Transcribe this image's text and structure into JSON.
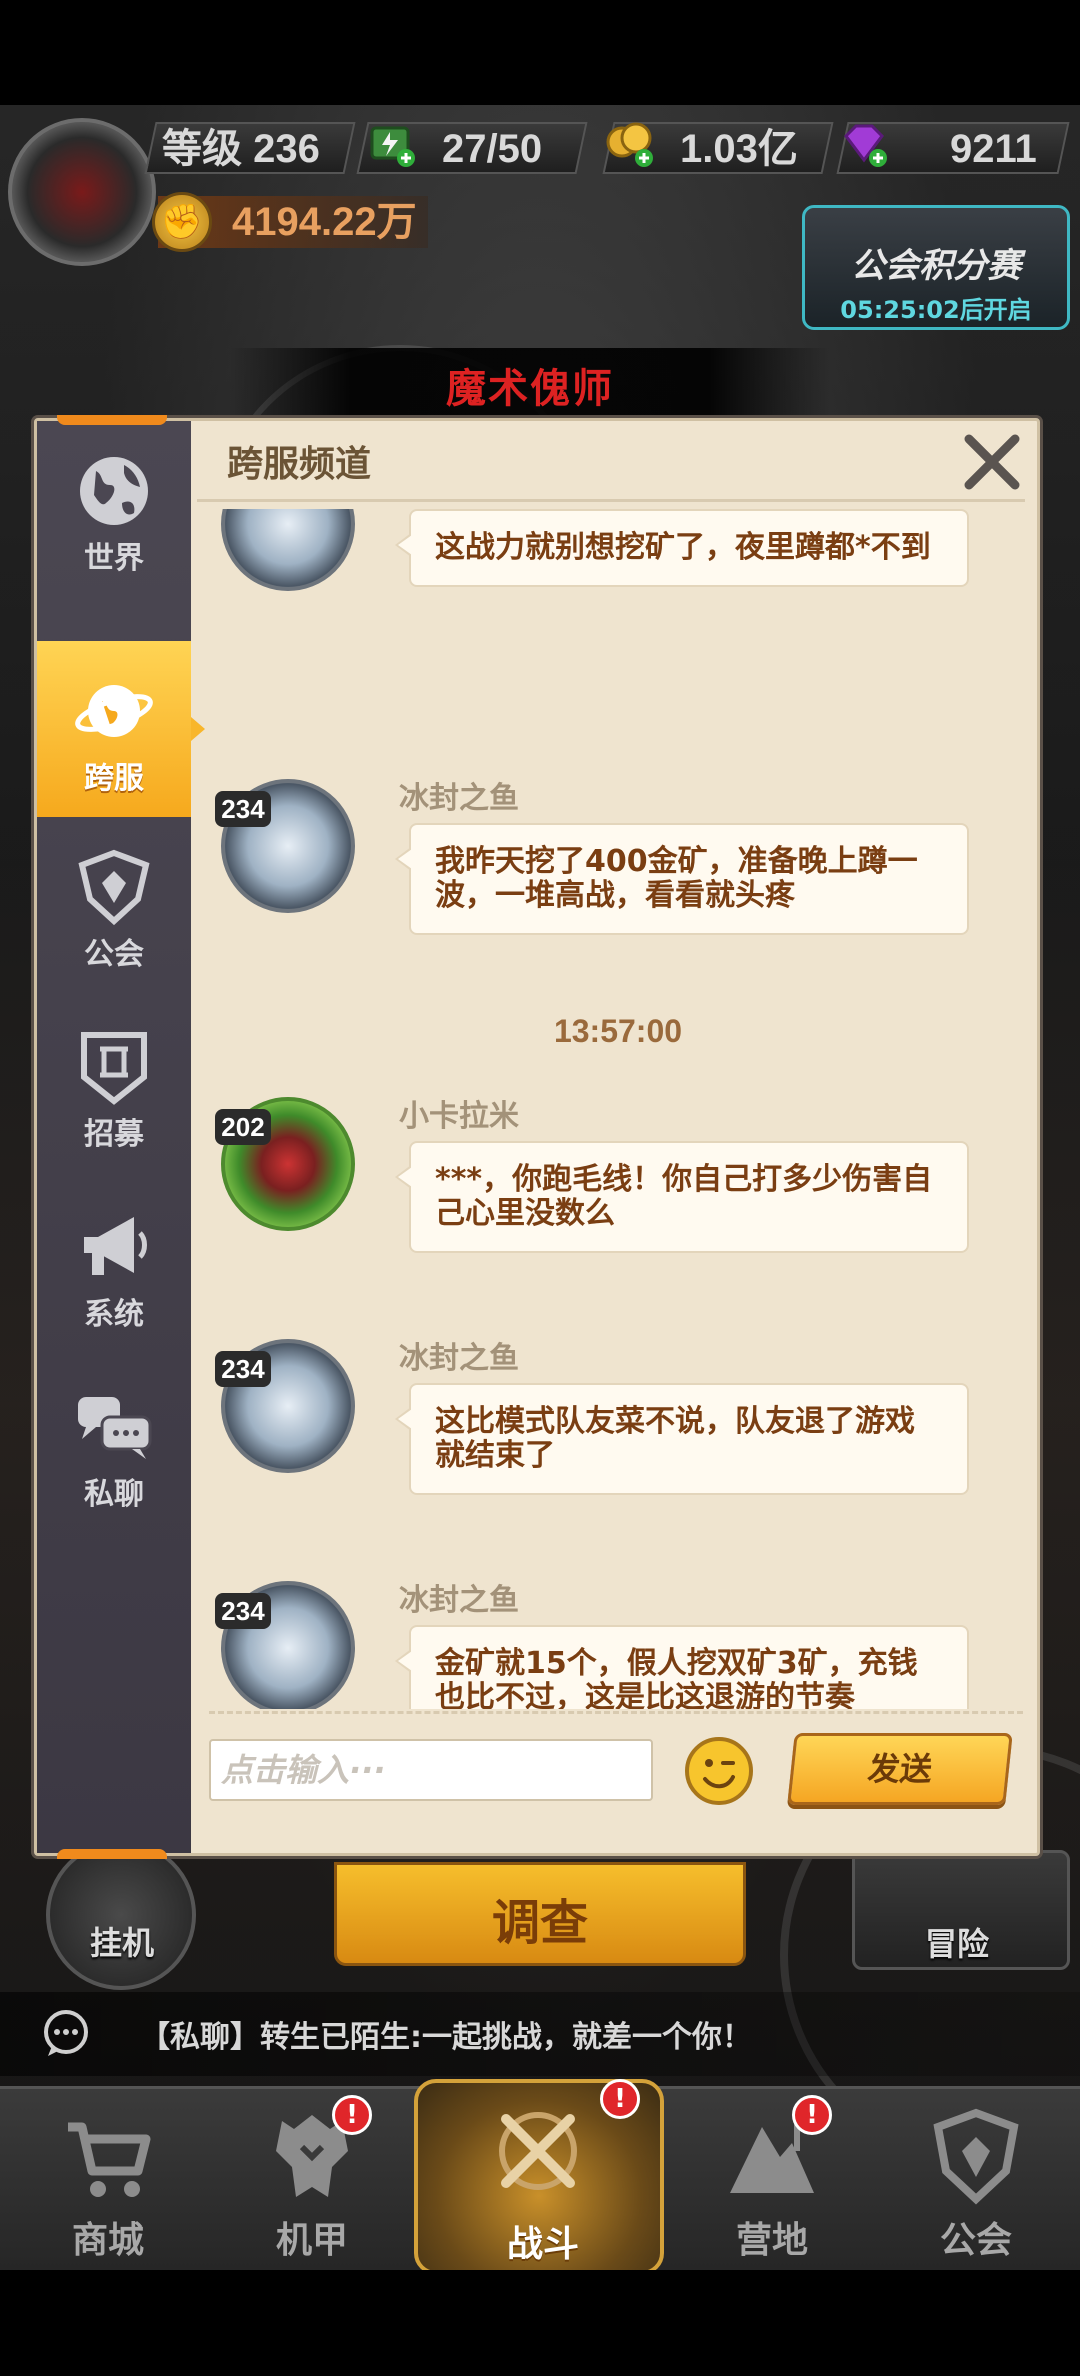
{
  "hud": {
    "level_label": "等级 236",
    "stamina": "27/50",
    "gold": "1.03亿",
    "gems": "9211",
    "power": "4194.22万"
  },
  "event": {
    "title": "公会积分赛",
    "timer": "05:25:02后开启"
  },
  "boss": {
    "name": "魔术傀师"
  },
  "dialog": {
    "title": "跨服频道",
    "tabs": [
      {
        "label": "世界",
        "icon": "globe-icon",
        "active": false
      },
      {
        "label": "跨服",
        "icon": "planet-icon",
        "active": true
      },
      {
        "label": "公会",
        "icon": "guild-shield-icon",
        "active": false
      },
      {
        "label": "招募",
        "icon": "recruit-icon",
        "active": false
      },
      {
        "label": "系统",
        "icon": "megaphone-icon",
        "active": false
      },
      {
        "label": "私聊",
        "icon": "chat-bubbles-icon",
        "active": false
      }
    ],
    "messages": [
      {
        "name": "",
        "level": "",
        "avatar": "silver-mech",
        "text": "这战力就别想挖矿了，夜里蹲都*不到"
      },
      {
        "name": "冰封之鱼",
        "level": "234",
        "avatar": "silver-mech",
        "text": "我昨天挖了400金矿，准备晚上蹲一波，一堆高战，看看就头疼"
      },
      {
        "name": "小卡拉米",
        "level": "202",
        "avatar": "green-mech",
        "text": "***，你跑毛线！你自己打多少伤害自己心里没数么"
      },
      {
        "name": "冰封之鱼",
        "level": "234",
        "avatar": "silver-mech",
        "text": "这比模式队友菜不说，队友退了游戏就结束了"
      },
      {
        "name": "冰封之鱼",
        "level": "234",
        "avatar": "silver-mech",
        "text": "金矿就15个，假人挖双矿3矿，充钱也比不过，这是比这退游的节奏"
      }
    ],
    "timestamp": "13:57:00",
    "input_placeholder": "点击输入···",
    "send_label": "发送"
  },
  "scene": {
    "idle_label": "挂机",
    "investigate_label": "调查",
    "adventure_label": "冒险"
  },
  "ticker": {
    "text": "【私聊】转生已陌生:一起挑战，就差一个你！"
  },
  "nav": [
    {
      "label": "商城",
      "icon": "cart-icon",
      "badge": false,
      "active": false
    },
    {
      "label": "机甲",
      "icon": "mech-icon",
      "badge": true,
      "active": false
    },
    {
      "label": "战斗",
      "icon": "crossed-swords-icon",
      "badge": true,
      "active": true
    },
    {
      "label": "营地",
      "icon": "camp-icon",
      "badge": true,
      "active": false
    },
    {
      "label": "公会",
      "icon": "guild-shield-icon",
      "badge": false,
      "active": false
    }
  ],
  "badge_mark": "!",
  "colors": {
    "accent_orange": "#f5a623",
    "bubble_text": "#7a3e12",
    "name_text": "#a39279",
    "timestamp": "#9a6a3c",
    "badge_red": "#e0262a"
  }
}
